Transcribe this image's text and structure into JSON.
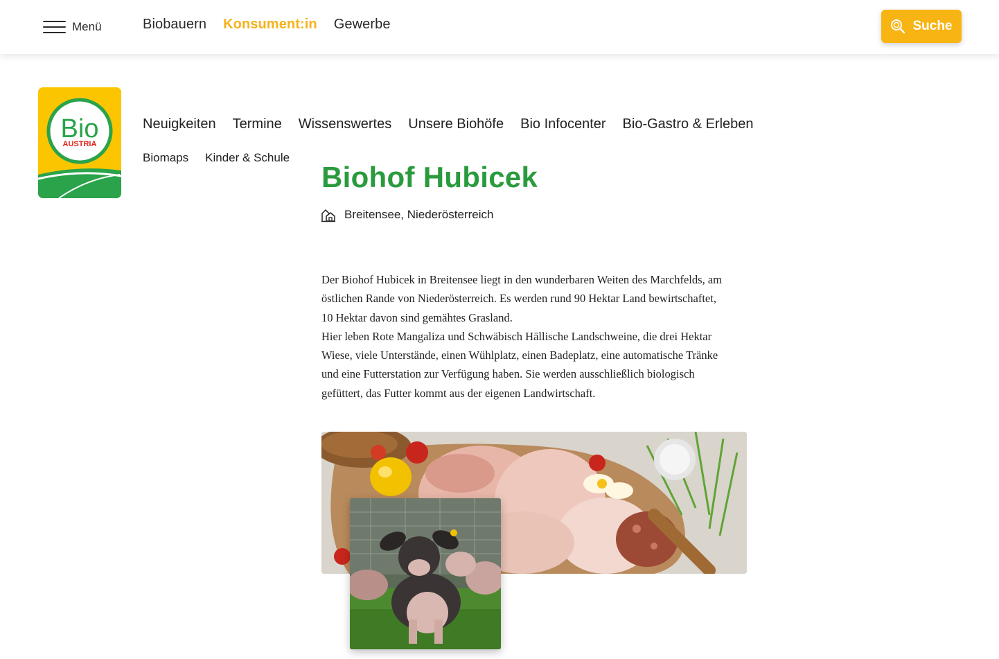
{
  "topbar": {
    "menu_label": "Menü",
    "audience_links": [
      "Biobauern",
      "Konsument:in",
      "Gewerbe"
    ],
    "active_audience": "Konsument:in",
    "search_label": "Suche",
    "accent_color": "#f8b413"
  },
  "logo": {
    "text_main": "Bio",
    "text_sub": "AUSTRIA"
  },
  "main_nav": [
    "Neuigkeiten",
    "Termine",
    "Wissenswertes",
    "Unsere Biohöfe",
    "Bio Infocenter",
    "Bio-Gastro & Erleben"
  ],
  "sub_nav": [
    "Biomaps",
    "Kinder & Schule"
  ],
  "farm": {
    "title": "Biohof Hubicek",
    "title_color": "#2a9b3d",
    "location": "Breitensee, Niederösterreich",
    "location_icon": "farm-house-icon",
    "description_lines": [
      "Der Biohof Hubicek in Breitensee liegt in den wunderbaren Weiten des Marchfelds, am",
      "östlichen Rande von Niederösterreich. Es werden rund 90 Hektar Land bewirtschaftet,",
      "10 Hektar davon sind gemähtes Grasland.",
      "Hier leben Rote Mangaliza und Schwäbisch Hällische Landschweine, die drei Hektar",
      "Wiese, viele Unterstände, einen Wühlplatz, einen Badeplatz, eine automatische Tränke",
      "und eine Futterstation zur Verfügung haben. Sie werden ausschließlich biologisch",
      "gefüttert, das Futter kommt aus der eigenen Landwirtschaft."
    ]
  }
}
